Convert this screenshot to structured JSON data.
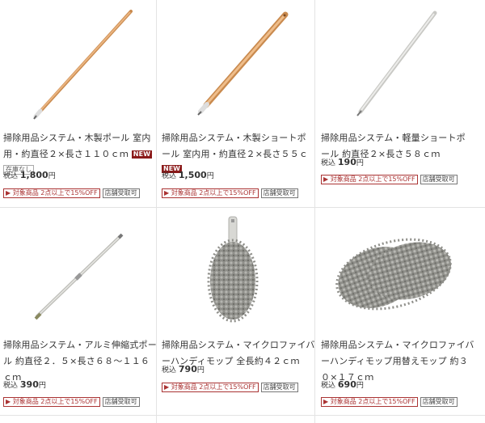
{
  "products": [
    {
      "name": "掃除用品システム・木製ポール 室内用・約直径２×長さ１１０ｃｍ",
      "badge": "NEW",
      "stock": "在庫なし",
      "price_prefix": "税込",
      "price": "1,800",
      "price_suffix": "円",
      "tag_discount": "▶ 対象商品 2点以上で15%OFF",
      "tag_store": "店舗受取可",
      "icon": "wooden-pole"
    },
    {
      "name": "掃除用品システム・木製ショートポール 室内用・約直径２×長さ５５ｃｍ",
      "badge": "NEW",
      "price_prefix": "税込",
      "price": "1,500",
      "price_suffix": "円",
      "tag_discount": "▶ 対象商品 2点以上で15%OFF",
      "tag_store": "店舗受取可",
      "icon": "wooden-short-pole"
    },
    {
      "name": "掃除用品システム・軽量ショートポール 約直径２×長さ５８ｃｍ",
      "price_prefix": "税込",
      "price": "190",
      "price_suffix": "円",
      "tag_discount": "▶ 対象商品 2点以上で15%OFF",
      "tag_store": "店舗受取可",
      "icon": "light-short-pole"
    },
    {
      "name": "掃除用品システム・アルミ伸縮式ポール 約直径２．５×長さ６８～１１６ｃｍ",
      "price_prefix": "税込",
      "price": "390",
      "price_suffix": "円",
      "tag_discount": "▶ 対象商品 2点以上で15%OFF",
      "tag_store": "店舗受取可",
      "icon": "aluminum-pole"
    },
    {
      "name": "掃除用品システム・マイクロファイバーハンディモップ 全長約４２ｃｍ",
      "price_prefix": "税込",
      "price": "790",
      "price_suffix": "円",
      "tag_discount": "▶ 対象商品 2点以上で15%OFF",
      "tag_store": "店舗受取可",
      "icon": "handy-mop"
    },
    {
      "name": "掃除用品システム・マイクロファイバーハンディモップ用替えモップ 約３０×１７ｃｍ",
      "price_prefix": "税込",
      "price": "690",
      "price_suffix": "円",
      "tag_discount": "▶ 対象商品 2点以上で15%OFF",
      "tag_store": "店舗受取可",
      "icon": "replacement-mop"
    }
  ],
  "colors": {
    "new_badge": "#8b1a1a",
    "discount_tag": "#aa3333",
    "wood": "#e0a06a",
    "mop": "#8f8f8a"
  }
}
